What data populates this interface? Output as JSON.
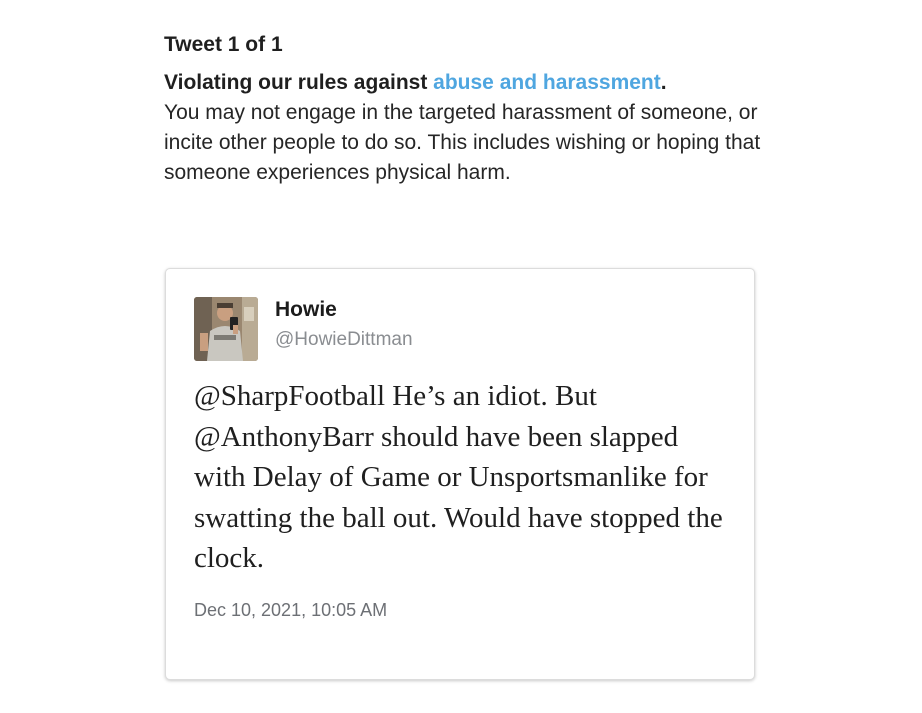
{
  "notice": {
    "tweet_count": "Tweet 1 of 1",
    "violation_prefix": "Violating our rules against ",
    "violation_link": "abuse and harassment",
    "violation_suffix": ".",
    "violation_body": "You may not engage in the targeted harassment of someone, or incite other people to do so. This includes wishing or hoping that someone experiences physical harm."
  },
  "tweet": {
    "display_name": "Howie",
    "handle": "@HowieDittman",
    "text": "@SharpFootball He’s an idiot. But @AnthonyBarr should have been slapped with Delay of Game or Unsportsmanlike for swatting the ball out. Would have stopped the clock.",
    "timestamp": "Dec 10, 2021, 10:05 AM",
    "avatar_icon": "user-avatar-photo"
  },
  "colors": {
    "link": "#4fa6e0",
    "handle": "#8a8d91",
    "timestamp": "#6d7075"
  }
}
